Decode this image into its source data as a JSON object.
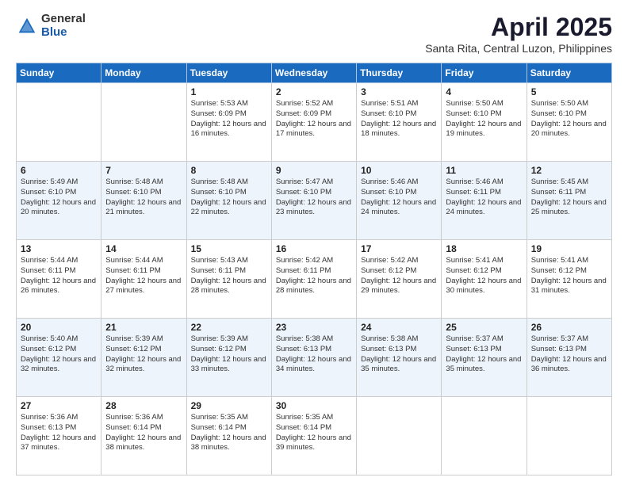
{
  "header": {
    "logo_general": "General",
    "logo_blue": "Blue",
    "title": "April 2025",
    "subtitle": "Santa Rita, Central Luzon, Philippines"
  },
  "weekdays": [
    "Sunday",
    "Monday",
    "Tuesday",
    "Wednesday",
    "Thursday",
    "Friday",
    "Saturday"
  ],
  "weeks": [
    [
      {
        "day": "",
        "info": ""
      },
      {
        "day": "",
        "info": ""
      },
      {
        "day": "1",
        "info": "Sunrise: 5:53 AM\nSunset: 6:09 PM\nDaylight: 12 hours and 16 minutes."
      },
      {
        "day": "2",
        "info": "Sunrise: 5:52 AM\nSunset: 6:09 PM\nDaylight: 12 hours and 17 minutes."
      },
      {
        "day": "3",
        "info": "Sunrise: 5:51 AM\nSunset: 6:10 PM\nDaylight: 12 hours and 18 minutes."
      },
      {
        "day": "4",
        "info": "Sunrise: 5:50 AM\nSunset: 6:10 PM\nDaylight: 12 hours and 19 minutes."
      },
      {
        "day": "5",
        "info": "Sunrise: 5:50 AM\nSunset: 6:10 PM\nDaylight: 12 hours and 20 minutes."
      }
    ],
    [
      {
        "day": "6",
        "info": "Sunrise: 5:49 AM\nSunset: 6:10 PM\nDaylight: 12 hours and 20 minutes."
      },
      {
        "day": "7",
        "info": "Sunrise: 5:48 AM\nSunset: 6:10 PM\nDaylight: 12 hours and 21 minutes."
      },
      {
        "day": "8",
        "info": "Sunrise: 5:48 AM\nSunset: 6:10 PM\nDaylight: 12 hours and 22 minutes."
      },
      {
        "day": "9",
        "info": "Sunrise: 5:47 AM\nSunset: 6:10 PM\nDaylight: 12 hours and 23 minutes."
      },
      {
        "day": "10",
        "info": "Sunrise: 5:46 AM\nSunset: 6:10 PM\nDaylight: 12 hours and 24 minutes."
      },
      {
        "day": "11",
        "info": "Sunrise: 5:46 AM\nSunset: 6:11 PM\nDaylight: 12 hours and 24 minutes."
      },
      {
        "day": "12",
        "info": "Sunrise: 5:45 AM\nSunset: 6:11 PM\nDaylight: 12 hours and 25 minutes."
      }
    ],
    [
      {
        "day": "13",
        "info": "Sunrise: 5:44 AM\nSunset: 6:11 PM\nDaylight: 12 hours and 26 minutes."
      },
      {
        "day": "14",
        "info": "Sunrise: 5:44 AM\nSunset: 6:11 PM\nDaylight: 12 hours and 27 minutes."
      },
      {
        "day": "15",
        "info": "Sunrise: 5:43 AM\nSunset: 6:11 PM\nDaylight: 12 hours and 28 minutes."
      },
      {
        "day": "16",
        "info": "Sunrise: 5:42 AM\nSunset: 6:11 PM\nDaylight: 12 hours and 28 minutes."
      },
      {
        "day": "17",
        "info": "Sunrise: 5:42 AM\nSunset: 6:12 PM\nDaylight: 12 hours and 29 minutes."
      },
      {
        "day": "18",
        "info": "Sunrise: 5:41 AM\nSunset: 6:12 PM\nDaylight: 12 hours and 30 minutes."
      },
      {
        "day": "19",
        "info": "Sunrise: 5:41 AM\nSunset: 6:12 PM\nDaylight: 12 hours and 31 minutes."
      }
    ],
    [
      {
        "day": "20",
        "info": "Sunrise: 5:40 AM\nSunset: 6:12 PM\nDaylight: 12 hours and 32 minutes."
      },
      {
        "day": "21",
        "info": "Sunrise: 5:39 AM\nSunset: 6:12 PM\nDaylight: 12 hours and 32 minutes."
      },
      {
        "day": "22",
        "info": "Sunrise: 5:39 AM\nSunset: 6:12 PM\nDaylight: 12 hours and 33 minutes."
      },
      {
        "day": "23",
        "info": "Sunrise: 5:38 AM\nSunset: 6:13 PM\nDaylight: 12 hours and 34 minutes."
      },
      {
        "day": "24",
        "info": "Sunrise: 5:38 AM\nSunset: 6:13 PM\nDaylight: 12 hours and 35 minutes."
      },
      {
        "day": "25",
        "info": "Sunrise: 5:37 AM\nSunset: 6:13 PM\nDaylight: 12 hours and 35 minutes."
      },
      {
        "day": "26",
        "info": "Sunrise: 5:37 AM\nSunset: 6:13 PM\nDaylight: 12 hours and 36 minutes."
      }
    ],
    [
      {
        "day": "27",
        "info": "Sunrise: 5:36 AM\nSunset: 6:13 PM\nDaylight: 12 hours and 37 minutes."
      },
      {
        "day": "28",
        "info": "Sunrise: 5:36 AM\nSunset: 6:14 PM\nDaylight: 12 hours and 38 minutes."
      },
      {
        "day": "29",
        "info": "Sunrise: 5:35 AM\nSunset: 6:14 PM\nDaylight: 12 hours and 38 minutes."
      },
      {
        "day": "30",
        "info": "Sunrise: 5:35 AM\nSunset: 6:14 PM\nDaylight: 12 hours and 39 minutes."
      },
      {
        "day": "",
        "info": ""
      },
      {
        "day": "",
        "info": ""
      },
      {
        "day": "",
        "info": ""
      }
    ]
  ]
}
